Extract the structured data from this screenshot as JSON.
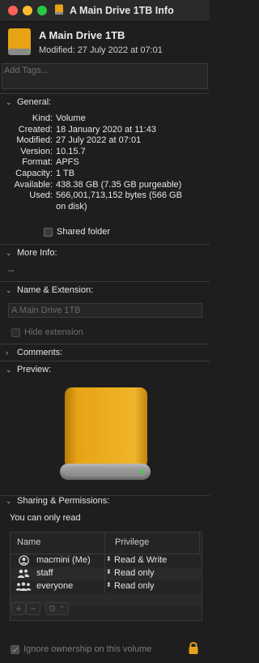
{
  "window": {
    "title": "A Main Drive 1TB Info"
  },
  "header": {
    "name": "A Main Drive 1TB",
    "modified": "Modified: 27 July 2022 at 07:01"
  },
  "tags": {
    "placeholder": "Add Tags..."
  },
  "general": {
    "label": "General:",
    "rows": [
      {
        "k": "Kind:",
        "v": "Volume"
      },
      {
        "k": "Created:",
        "v": "18 January 2020 at 11:43"
      },
      {
        "k": "Modified:",
        "v": "27 July 2022 at 07:01"
      },
      {
        "k": "Version:",
        "v": "10.15.7"
      },
      {
        "k": "Format:",
        "v": "APFS"
      },
      {
        "k": "Capacity:",
        "v": "1 TB"
      },
      {
        "k": "Available:",
        "v": "438.38 GB (7.35 GB purgeable)"
      },
      {
        "k": "Used:",
        "v": "566,001,713,152 bytes (566 GB"
      },
      {
        "k": "",
        "v": "on disk)"
      }
    ],
    "shared_folder": "Shared folder"
  },
  "more_info": {
    "label": "More Info:",
    "value": "--"
  },
  "name_ext": {
    "label": "Name & Extension:",
    "name_value": "A Main Drive 1TB",
    "hide_extension": "Hide extension"
  },
  "comments": {
    "label": "Comments:"
  },
  "preview": {
    "label": "Preview:"
  },
  "sharing": {
    "label": "Sharing & Permissions:",
    "status": "You can only read",
    "col_name": "Name",
    "col_privilege": "Privilege",
    "rows": [
      {
        "name": "macmini (Me)",
        "privilege": "Read & Write"
      },
      {
        "name": "staff",
        "privilege": "Read only"
      },
      {
        "name": "everyone",
        "privilege": "Read only"
      }
    ],
    "ignore_ownership": "Ignore ownership on this volume"
  },
  "toolbar": {
    "add": "+",
    "remove": "−",
    "action": "⊙",
    "action_chevron": "⌄"
  },
  "chevrons": {
    "expanded": "⌄",
    "collapsed": "›"
  },
  "colors": {
    "drive_body": "#e6a316",
    "drive_base": "#8a8a8a",
    "led": "#39d24a",
    "lock": "#e6a21c"
  }
}
